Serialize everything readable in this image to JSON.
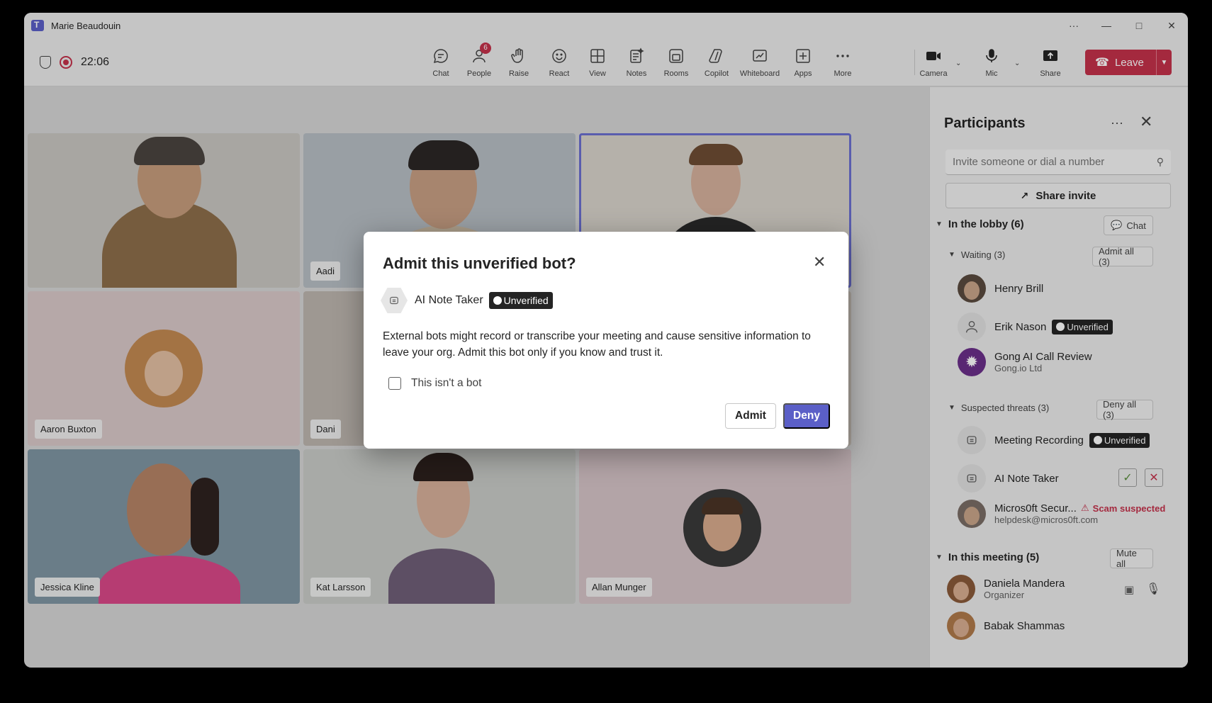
{
  "window": {
    "title": "Marie Beaudouin"
  },
  "toolbar": {
    "timer": "22:06",
    "tools": [
      {
        "label": "Chat"
      },
      {
        "label": "People",
        "badge": "6"
      },
      {
        "label": "Raise"
      },
      {
        "label": "React"
      },
      {
        "label": "View"
      },
      {
        "label": "Notes"
      },
      {
        "label": "Rooms"
      },
      {
        "label": "Copilot"
      },
      {
        "label": "Whiteboard"
      },
      {
        "label": "Apps"
      },
      {
        "label": "More"
      },
      {
        "label": "Camera"
      },
      {
        "label": "Mic"
      },
      {
        "label": "Share"
      }
    ],
    "leave_label": "Leave"
  },
  "stage": {
    "tiles": [
      {
        "name": ""
      },
      {
        "name": "Aadi"
      },
      {
        "name": ""
      },
      {
        "name": "Aaron Buxton"
      },
      {
        "name": "Dani"
      },
      {
        "name": ""
      },
      {
        "name": "Jessica Kline"
      },
      {
        "name": "Kat Larsson"
      },
      {
        "name": "Allan Munger"
      }
    ]
  },
  "panel": {
    "title": "Participants",
    "invite_placeholder": "Invite someone or dial a number",
    "share_invite": "Share invite",
    "lobby": {
      "label": "In the lobby (6)",
      "chat_label": "Chat",
      "waiting": {
        "label": "Waiting (3)",
        "admit_all": "Admit all (3)",
        "people": [
          {
            "name": "Henry Brill"
          },
          {
            "name": "Erik Nason",
            "badge": "Unverified"
          },
          {
            "name": "Gong AI Call Review",
            "sub": "Gong.io Ltd"
          }
        ]
      },
      "threats": {
        "label": "Suspected threats (3)",
        "deny_all": "Deny all (3)",
        "people": [
          {
            "name": "Meeting Recording",
            "badge": "Unverified"
          },
          {
            "name": "AI Note Taker"
          },
          {
            "name": "Micros0ft Secur...",
            "sub": "helpdesk@micros0ft.com",
            "warning": "Scam suspected"
          }
        ]
      }
    },
    "meeting": {
      "label": "In this meeting (5)",
      "mute_all": "Mute all",
      "people": [
        {
          "name": "Daniela Mandera",
          "sub": "Organizer"
        },
        {
          "name": "Babak Shammas"
        }
      ]
    }
  },
  "dialog": {
    "title": "Admit this unverified bot?",
    "bot_name": "AI Note Taker",
    "badge": "Unverified",
    "body": "External bots might record or transcribe your meeting and cause sensitive information to leave your org. Admit this bot only if you know and trust it.",
    "checkbox_label": "This isn't a bot",
    "admit": "Admit",
    "deny": "Deny"
  },
  "colors": {
    "brand": "#5b5fc7",
    "danger": "#c4314b"
  }
}
